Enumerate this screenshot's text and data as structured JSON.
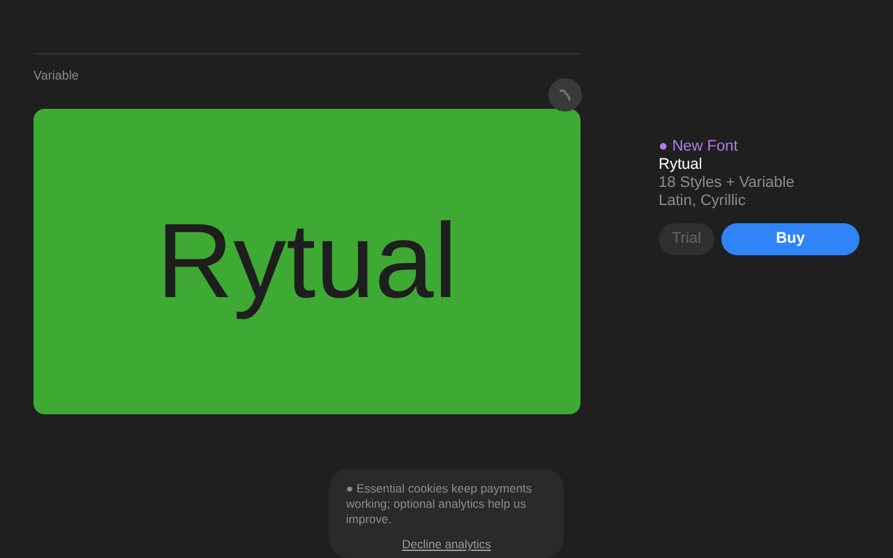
{
  "preview": {
    "label": "Variable",
    "sample": "Rytual"
  },
  "product": {
    "tag": "● New Font",
    "name": "Rytual",
    "styles": "18 Styles + Variable",
    "scripts": "Latin, Cyrillic"
  },
  "buttons": [
    {
      "label": "Trial",
      "disabled": true
    },
    {
      "label": "Buy",
      "disabled": false
    }
  ],
  "cookie_notice": {
    "text": "● Essential cookies keep payments working; optional analytics help us improve.",
    "action": "Decline analytics"
  }
}
